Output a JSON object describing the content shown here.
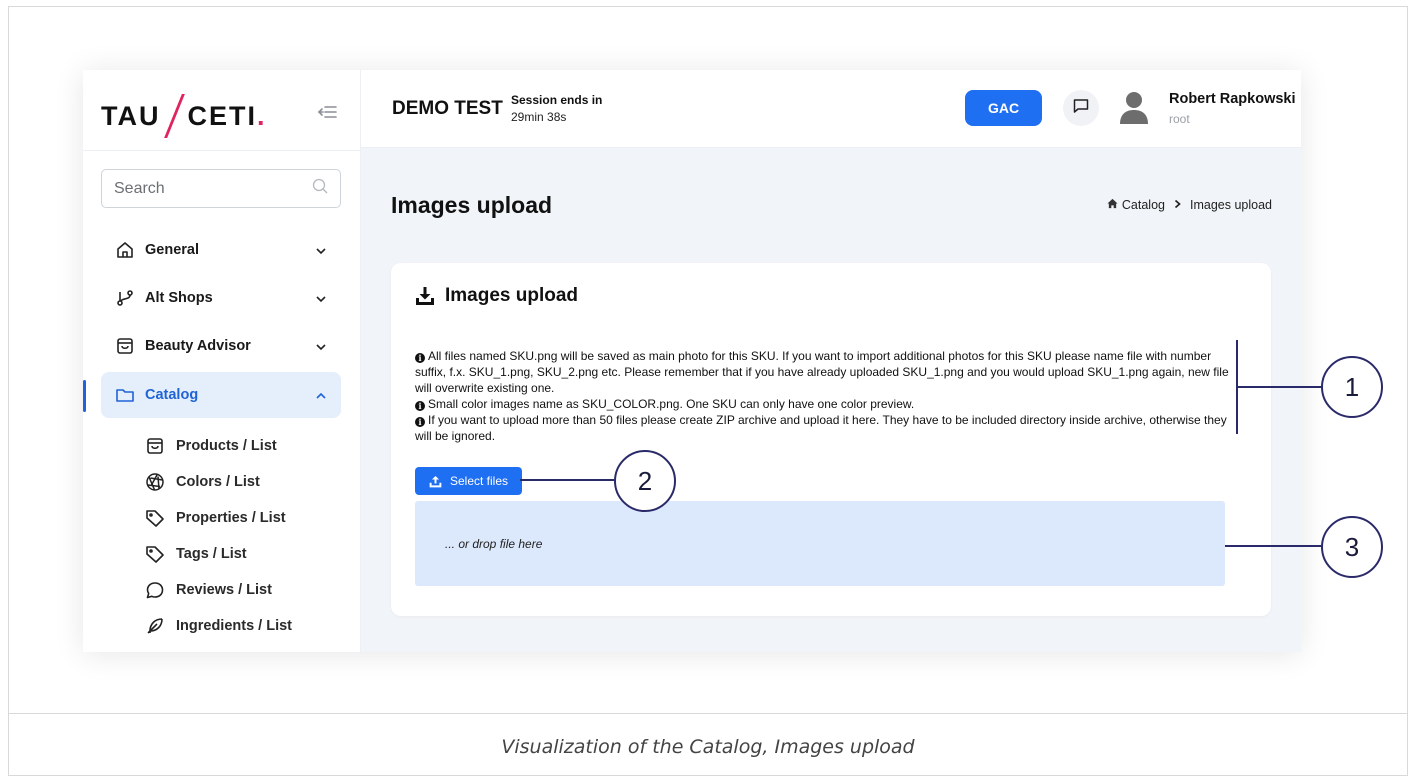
{
  "sidebar": {
    "logo_left": "TAU",
    "logo_right": "CETI",
    "logo_dot": ".",
    "search_placeholder": "Search",
    "items": [
      {
        "label": "General",
        "icon": "home-icon"
      },
      {
        "label": "Alt Shops",
        "icon": "branch-icon"
      },
      {
        "label": "Beauty Advisor",
        "icon": "shopping-bag-icon"
      },
      {
        "label": "Catalog",
        "icon": "folder-icon",
        "active": true
      }
    ],
    "sub_items": [
      {
        "label": "Products / List",
        "icon": "shopping-bag-icon"
      },
      {
        "label": "Colors / List",
        "icon": "aperture-icon"
      },
      {
        "label": "Properties / List",
        "icon": "tag-icon"
      },
      {
        "label": "Tags / List",
        "icon": "tag-icon"
      },
      {
        "label": "Reviews / List",
        "icon": "message-circle-icon"
      },
      {
        "label": "Ingredients / List",
        "icon": "feather-icon"
      }
    ]
  },
  "header": {
    "title": "DEMO TEST",
    "session_label": "Session ends in",
    "session_time": "29min 38s",
    "gac_label": "GAC",
    "user_name": "Robert Rapkowski",
    "user_role": "root"
  },
  "main": {
    "page_title": "Images upload",
    "breadcrumb": [
      "Catalog",
      "Images upload"
    ],
    "card_title": "Images upload",
    "info_lines": [
      "All files named SKU.png will be saved as main photo for this SKU. If you want to import additional photos for this SKU please name file with number suffix, f.x. SKU_1.png, SKU_2.png etc. Please remember that if you have already uploaded SKU_1.png and you would upload SKU_1.png again, new file will overwrite existing one.",
      "Small color images name as SKU_COLOR.png. One SKU can only have one color preview.",
      "If you want to upload more than 50 files please create ZIP archive and upload it here. They have to be included directory inside archive, otherwise they will be ignored."
    ],
    "select_files_label": "Select files",
    "drop_text": "... or drop file here"
  },
  "annotations": [
    "1",
    "2",
    "3"
  ],
  "caption": "Visualization of the Catalog, Images upload",
  "colors": {
    "accent": "#1f6ff2",
    "brand_red": "#e0245e",
    "active_bg": "#e5eefb",
    "drop_zone": "#dce8fb",
    "annotation": "#2a2a6a"
  }
}
